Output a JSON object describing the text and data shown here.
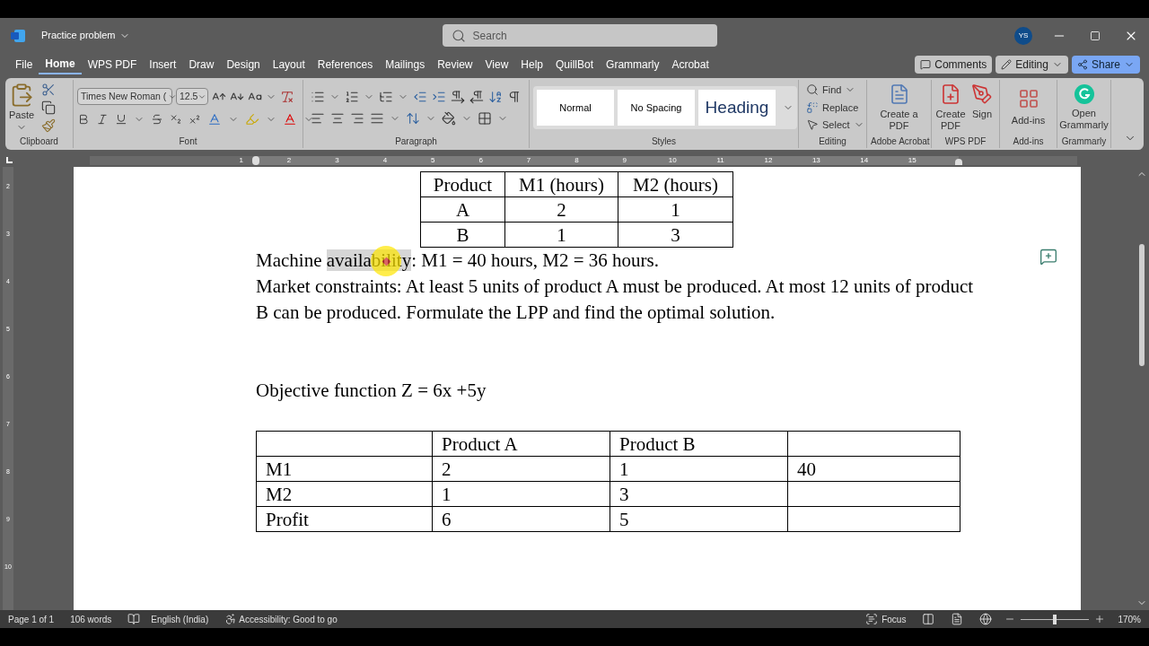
{
  "title_bar": {
    "doc_title": "Practice problem",
    "search_placeholder": "Search",
    "avatar": "YS"
  },
  "menu_tabs": [
    {
      "label": "File",
      "selected": false
    },
    {
      "label": "Home",
      "selected": true
    },
    {
      "label": "WPS PDF",
      "selected": false
    },
    {
      "label": "Insert",
      "selected": false
    },
    {
      "label": "Draw",
      "selected": false
    },
    {
      "label": "Design",
      "selected": false
    },
    {
      "label": "Layout",
      "selected": false
    },
    {
      "label": "References",
      "selected": false
    },
    {
      "label": "Mailings",
      "selected": false
    },
    {
      "label": "Review",
      "selected": false
    },
    {
      "label": "View",
      "selected": false
    },
    {
      "label": "Help",
      "selected": false
    },
    {
      "label": "QuillBot",
      "selected": false
    },
    {
      "label": "Grammarly",
      "selected": false
    },
    {
      "label": "Acrobat",
      "selected": false
    }
  ],
  "top_buttons": {
    "comments": "Comments",
    "editing": "Editing",
    "share": "Share"
  },
  "ribbon": {
    "paste": "Paste",
    "font_name": "Times New Roman (",
    "font_size": "12.5",
    "styles": [
      {
        "label": "Normal",
        "kind": "normal"
      },
      {
        "label": "No Spacing",
        "kind": "normal"
      },
      {
        "label": "Heading",
        "kind": "heading"
      }
    ],
    "editing": [
      "Find",
      "Replace",
      "Select"
    ],
    "create_a_pdf": "Create a PDF",
    "create_pdf": "Create PDF",
    "sign": "Sign",
    "add_ins": "Add-ins",
    "open_grammarly": "Open Grammarly",
    "groups": [
      "Clipboard",
      "Font",
      "Paragraph",
      "Styles",
      "Editing",
      "Adobe Acrobat",
      "WPS PDF",
      "Add-ins",
      "Grammarly"
    ]
  },
  "ruler": {
    "horizontal": [
      "1",
      "2",
      "3",
      "4",
      "5",
      "6",
      "7",
      "8",
      "9",
      "10",
      "11",
      "12",
      "13",
      "14",
      "15"
    ],
    "vertical": [
      "2",
      "3",
      "4",
      "5",
      "6",
      "7",
      "8",
      "9",
      "10"
    ]
  },
  "document": {
    "table_1": {
      "header": [
        "Product",
        "M1 (hours)",
        "M2 (hours)"
      ],
      "rows": [
        [
          "A",
          "2",
          "1"
        ],
        [
          "B",
          "1",
          "3"
        ]
      ]
    },
    "paragraph_1": {
      "before": "Machine ",
      "selection": "availability",
      "after": ": M1 = 40 hours, M2 = 36 hours."
    },
    "paragraph_2": "Market constraints: At least 5 units of product A must be produced. At most 12 units of product B can be produced. Formulate the LPP and find the optimal solution.",
    "paragraph_3": "Objective function Z = 6x +5y",
    "table_2": {
      "rows": [
        [
          null,
          "Product A",
          "Product B",
          null
        ],
        [
          "M1",
          "2",
          "1",
          "40"
        ],
        [
          "M2",
          "1",
          "3",
          null
        ],
        [
          "Profit",
          "6",
          "5",
          null
        ]
      ]
    }
  },
  "status_bar": {
    "page": "Page 1 of 1",
    "words": "106 words",
    "language": "English (India)",
    "accessibility": "Accessibility: Good to go",
    "focus": "Focus",
    "zoom_slider": {
      "level": 0.5
    },
    "zoom": "170%"
  }
}
